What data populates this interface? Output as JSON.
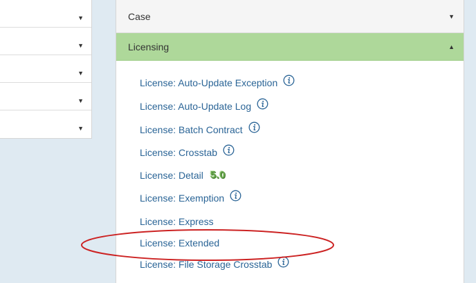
{
  "left_panel": {
    "rows": [
      {
        "caret": "▼"
      },
      {
        "caret": "▼"
      },
      {
        "caret": "▼"
      },
      {
        "caret": "▼"
      },
      {
        "caret": "▼"
      }
    ]
  },
  "accordion": {
    "case": {
      "label": "Case",
      "caret": "▼"
    },
    "licensing": {
      "label": "Licensing",
      "caret": "▲"
    }
  },
  "licensing_links": [
    {
      "label": "License: Auto-Update Exception",
      "info": true
    },
    {
      "label": "License: Auto-Update Log",
      "info": true
    },
    {
      "label": "License: Batch Contract",
      "info": true
    },
    {
      "label": "License: Crosstab",
      "info": true
    },
    {
      "label": "License: Detail",
      "badge": "5.0"
    },
    {
      "label": "License: Exemption",
      "info": true
    },
    {
      "label": "License: Express"
    },
    {
      "label": "License: Extended"
    },
    {
      "label": "License: File Storage Crosstab",
      "info": true
    }
  ],
  "colors": {
    "link": "#2a6496",
    "licensing_header_bg": "#aed89a",
    "highlight_ellipse": "#cc2222",
    "page_background": "#dfeaf2"
  },
  "icons": {
    "info": "info-icon",
    "caret_down": "caret-down-icon",
    "caret_up": "caret-up-icon"
  }
}
